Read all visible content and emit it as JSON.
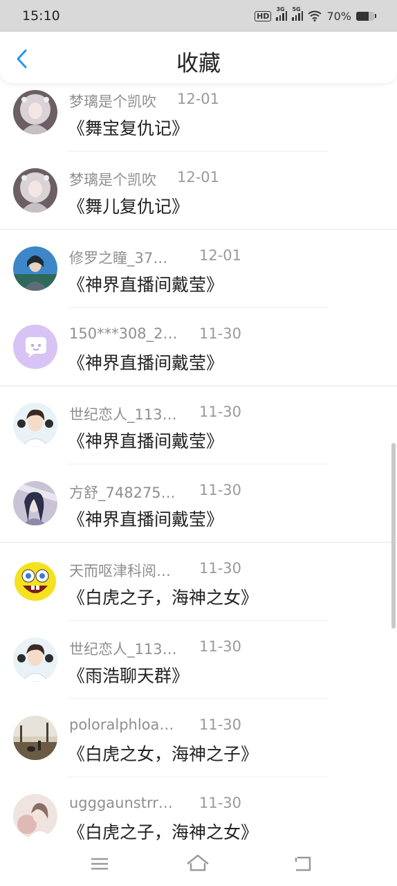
{
  "status": {
    "time": "15:10",
    "network1": "3G",
    "network2": "5G",
    "hd": "HD",
    "battery": "70%",
    "battery_level": 0.7
  },
  "header": {
    "title": "收藏"
  },
  "items": [
    {
      "name": "梦璃是个凯吹",
      "date": "12-01",
      "title": "《舞宝复仇记》",
      "avatar": "anime-girl-white"
    },
    {
      "name": "梦璃是个凯吹",
      "date": "12-01",
      "title": "《舞儿复仇记》",
      "avatar": "anime-girl-white"
    },
    {
      "name": "修罗之瞳_37…",
      "date": "12-01",
      "title": "《神界直播间戴莹》",
      "avatar": "anime-warrior"
    },
    {
      "name": "150***308_2…",
      "date": "11-30",
      "title": "《神界直播间戴莹》",
      "avatar": "chat-bubble"
    },
    {
      "name": "世纪恋人_113…",
      "date": "11-30",
      "title": "《神界直播间戴莹》",
      "avatar": "anime-boy"
    },
    {
      "name": "方舒_748275…",
      "date": "11-30",
      "title": "《神界直播间戴莹》",
      "avatar": "anime-girl-dark"
    },
    {
      "name": "天而呕津科阅…",
      "date": "11-30",
      "title": "《白虎之子，海神之女》",
      "avatar": "sponge-cartoon"
    },
    {
      "name": "世纪恋人_113…",
      "date": "11-30",
      "title": "《雨浩聊天群》",
      "avatar": "anime-boy"
    },
    {
      "name": "poloralphloa…",
      "date": "11-30",
      "title": "《白虎之女，海神之子》",
      "avatar": "outdoor-photo"
    },
    {
      "name": "ugggaunstrr…",
      "date": "11-30",
      "title": "《白虎之子，海神之女》",
      "avatar": "soft-photo"
    }
  ],
  "icons": {
    "back": "chevron-left-icon",
    "menu": "menu-icon",
    "home": "home-icon",
    "return": "return-icon"
  },
  "colors": {
    "accent": "#2196f3",
    "status_bar": "#d9d9d9",
    "name_text": "#8f8f8f"
  }
}
